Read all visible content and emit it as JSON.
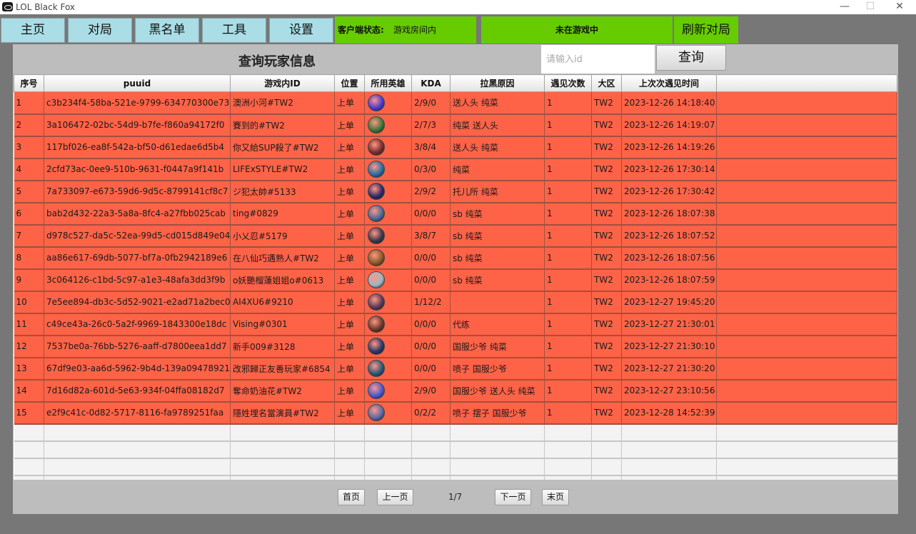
{
  "window": {
    "title": "LOL Black Fox",
    "minimize": "—",
    "maximize": "☐",
    "close": "✕"
  },
  "nav": {
    "home": "主页",
    "match": "对局",
    "blacklist": "黑名单",
    "tools": "工具",
    "settings": "设置"
  },
  "status": {
    "client_label": "客户端状态:",
    "client_value": "游戏房间内",
    "game_state": "未在游戏中",
    "refresh": "刷新对局"
  },
  "panel": {
    "title": "查询玩家信息",
    "search_placeholder": "请输入id",
    "search_button": "查询"
  },
  "table": {
    "columns": [
      "序号",
      "puuid",
      "游戏内ID",
      "位置",
      "所用英雄",
      "KDA",
      "拉黑原因",
      "遇见次数",
      "大区",
      "上次次遇见时间"
    ],
    "rows": [
      {
        "no": "1",
        "puuid": "c3b234f4-58ba-521e-9799-634770300e73",
        "gid": "澳洲小河#TW2",
        "pos": "上单",
        "hero": "#4a3bd6",
        "kda": "2/9/0",
        "reason": " 送人头 纯菜",
        "count": "1",
        "region": "TW2",
        "time": "2023-12-26 14:18:40"
      },
      {
        "no": "2",
        "puuid": "3a106472-02bc-54d9-b7fe-f860a94172f0",
        "gid": "賽到的#TW2",
        "pos": "上单",
        "hero": "#3c7a3a",
        "kda": "2/7/3",
        "reason": " 纯菜 送人头",
        "count": "1",
        "region": "TW2",
        "time": "2023-12-26 14:19:07"
      },
      {
        "no": "3",
        "puuid": "117bf026-ea8f-542a-bf50-d61edae6d5b4",
        "gid": "你又給SUP殺了#TW2",
        "pos": "上单",
        "hero": "#7a2e2e",
        "kda": "3/8/4",
        "reason": " 送人头 纯菜",
        "count": "1",
        "region": "TW2",
        "time": "2023-12-26 14:19:26"
      },
      {
        "no": "4",
        "puuid": "2cfd73ac-0ee9-510b-9631-f0447a9f141b",
        "gid": "LIFExSTYLE#TW2",
        "pos": "上单",
        "hero": "#2a6fa8",
        "kda": "0/3/0",
        "reason": " 纯菜",
        "count": "1",
        "region": "TW2",
        "time": "2023-12-26 17:30:14"
      },
      {
        "no": "5",
        "puuid": "7a733097-e673-59d6-9d5c-8799141cf8c7",
        "gid": "ジ犯太帥#5133",
        "pos": "上单",
        "hero": "#2e2a6a",
        "kda": "2/9/2",
        "reason": "托儿所 纯菜",
        "count": "1",
        "region": "TW2",
        "time": "2023-12-26 17:30:42"
      },
      {
        "no": "6",
        "puuid": "bab2d432-22a3-5a8a-8fc4-a27fbb025cab",
        "gid": "ting#0829",
        "pos": "上单",
        "hero": "#4a6a9a",
        "kda": "0/0/0",
        "reason": "sb 纯菜",
        "count": "1",
        "region": "TW2",
        "time": "2023-12-26 18:07:38"
      },
      {
        "no": "7",
        "puuid": "d978c527-da5c-52ea-99d5-cd015d849e04",
        "gid": "小乂忍#5179",
        "pos": "上单",
        "hero": "#3a3a4a",
        "kda": "3/8/7",
        "reason": "sb 纯菜",
        "count": "1",
        "region": "TW2",
        "time": "2023-12-26 18:07:52"
      },
      {
        "no": "8",
        "puuid": "aa86e617-69db-5077-bf7a-0fb2942189e6",
        "gid": "在八仙巧遇熟人#TW2",
        "pos": "上单",
        "hero": "#8a5a2a",
        "kda": "0/0/0",
        "reason": "sb 纯菜",
        "count": "1",
        "region": "TW2",
        "time": "2023-12-26 18:07:56"
      },
      {
        "no": "9",
        "puuid": "3c064126-c1bd-5c97-a1e3-48afa3dd3f9b",
        "gid": "o妖艷榴蓮姐姐o#0613",
        "pos": "上单",
        "hero": "#9ab8c8",
        "kda": "0/0/0",
        "reason": "sb 纯菜",
        "count": "1",
        "region": "TW2",
        "time": "2023-12-26 18:07:59"
      },
      {
        "no": "10",
        "puuid": "7e5ee894-db3c-5d52-9021-e2ad71a2bec0",
        "gid": "AI4XU6#9210",
        "pos": "上单",
        "hero": "#5a3a5a",
        "kda": "1/12/2",
        "reason": "",
        "count": "1",
        "region": "TW2",
        "time": "2023-12-27 19:45:20"
      },
      {
        "no": "11",
        "puuid": "c49ce43a-26c0-5a2f-9969-1843300e18dc",
        "gid": "Vising#0301",
        "pos": "上单",
        "hero": "#6a3a2a",
        "kda": "0/0/0",
        "reason": "代练",
        "count": "1",
        "region": "TW2",
        "time": "2023-12-27 21:30:01"
      },
      {
        "no": "12",
        "puuid": "7537be0a-76bb-5276-aaff-d7800eea1dd7",
        "gid": "新手009#3128",
        "pos": "上单",
        "hero": "#2a3a6a",
        "kda": "0/0/0",
        "reason": " 国服少爷 纯菜",
        "count": "1",
        "region": "TW2",
        "time": "2023-12-27 21:30:10"
      },
      {
        "no": "13",
        "puuid": "67df9e03-aa6d-5962-9b4d-139a09478921",
        "gid": "改邪歸正友善玩家#6854",
        "pos": "上单",
        "hero": "#2a5a7a",
        "kda": "0/0/0",
        "reason": " 喷子 国服少爷",
        "count": "1",
        "region": "TW2",
        "time": "2023-12-27 21:30:20"
      },
      {
        "no": "14",
        "puuid": "7d16d82a-601d-5e63-934f-04ffa08182d7",
        "gid": "奪命奶油花#TW2",
        "pos": "上单",
        "hero": "#4a5ad8",
        "kda": "2/9/0",
        "reason": "国服少爷 送人头 纯菜",
        "count": "1",
        "region": "TW2",
        "time": "2023-12-27 23:10:56"
      },
      {
        "no": "15",
        "puuid": "e2f9c41c-0d82-5717-8116-fa9789251faa",
        "gid": "隱姓埋名當演員#TW2",
        "pos": "上单",
        "hero": "#5a6aa8",
        "kda": "0/2/2",
        "reason": "  喷子 摆子 国服少爷",
        "count": "1",
        "region": "TW2",
        "time": "2023-12-28 14:52:39"
      }
    ]
  },
  "pager": {
    "first": "首页",
    "prev": "上一页",
    "indicator": "1/7",
    "next": "下一页",
    "last": "末页"
  }
}
